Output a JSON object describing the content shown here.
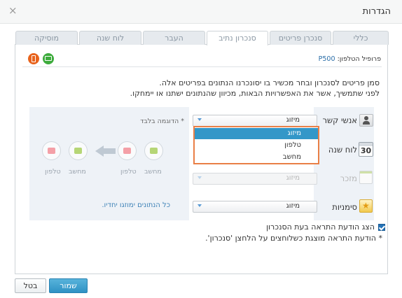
{
  "window": {
    "title": "הגדרות",
    "close_icon": "close-icon"
  },
  "tabs": [
    {
      "label": "כללי",
      "active": false
    },
    {
      "label": "סנכרן פריטים",
      "active": false
    },
    {
      "label": "סנכרון נתיב",
      "active": true
    },
    {
      "label": "העבר",
      "active": false
    },
    {
      "label": "לוח שנה",
      "active": false
    },
    {
      "label": "מוסיקה",
      "active": false
    }
  ],
  "profile": {
    "label": "פרופיל הטלפון:",
    "model": "P500"
  },
  "instructions": {
    "line1": "סמן פריטים לסנכרון ובחר מכשיר בו יסונכרנו הנתונים בפריטים אלה.",
    "line2": "לפני שתמשיך, אשר את האפשרויות הבאות, מכיוון שהנתונים ישתנו או יימחקו."
  },
  "rows": [
    {
      "label": "אנשי קשר",
      "value": "מיזוג",
      "enabled": true,
      "icon": "contacts-icon"
    },
    {
      "label": "לוח שנה",
      "value": "מיזוג",
      "enabled": true,
      "icon": "calendar-icon",
      "icon_text": "30"
    },
    {
      "label": "מזכר",
      "value": "מיזוג",
      "enabled": false,
      "icon": "memo-icon"
    },
    {
      "label": "סימניות",
      "value": "מיזוג",
      "enabled": true,
      "icon": "bookmarks-icon"
    }
  ],
  "dropdown": {
    "options": [
      "מיזוג",
      "טלפון",
      "מחשב"
    ],
    "selected": "מיזוג"
  },
  "example_note": "* הדוגמה בלבד",
  "merge_note": "כל הנתונים ימוזגו יחדיו.",
  "diagram": {
    "labels": [
      "מחשב",
      "טלפון",
      "מחשב",
      "טלפון"
    ]
  },
  "notify": {
    "checkbox_label": "הצג הודעת התראה בעת הסנכרון",
    "checked": true,
    "sub_note": "* הודעת התראה מוצגת כשלוחצים על הלחצן 'סנכרון'."
  },
  "buttons": {
    "save": "שמור",
    "cancel": "בטל"
  },
  "colors": {
    "accent": "#3397c8",
    "dropdown_border": "#e97f46",
    "phone_icon": "#e8631c",
    "pc_icon": "#3dab3c"
  }
}
